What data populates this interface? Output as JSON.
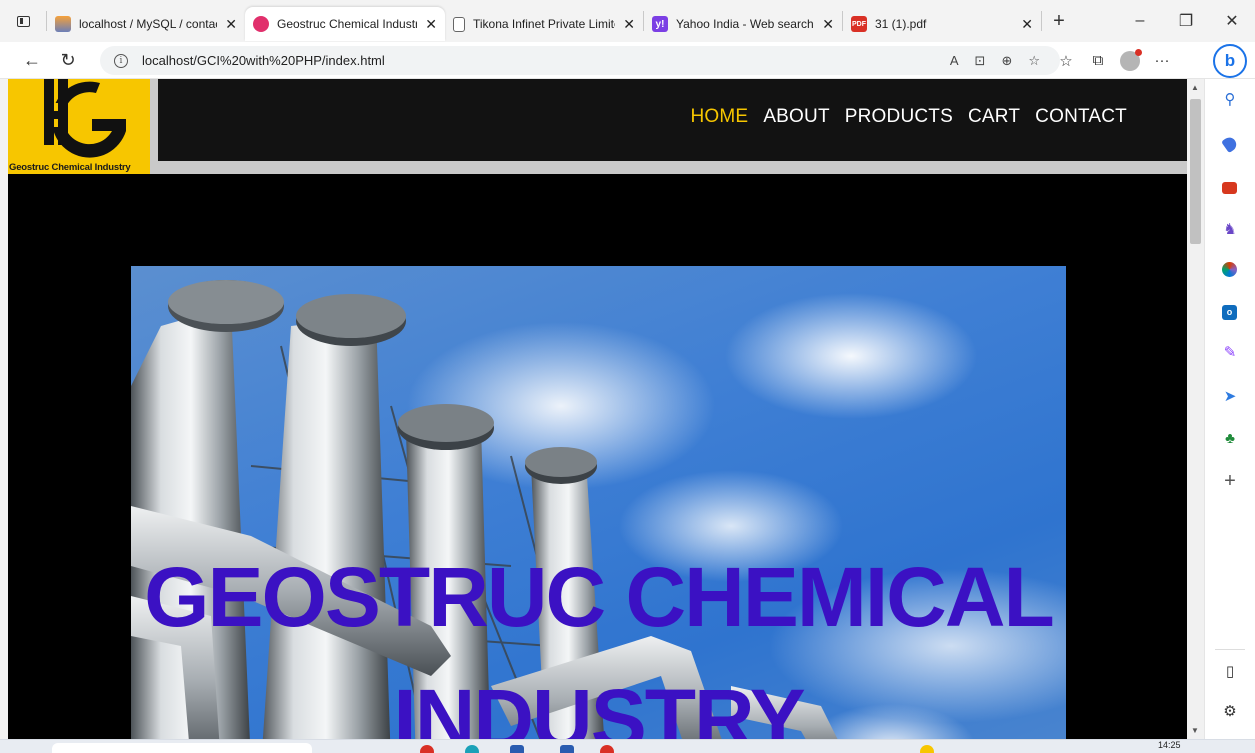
{
  "browser": {
    "tabs": [
      {
        "title": "localhost / MySQL / contactd",
        "favicon": "phpmyadmin-icon",
        "active": false
      },
      {
        "title": "Geostruc Chemical Industry",
        "favicon": "site-icon",
        "active": true
      },
      {
        "title": "Tikona Infinet Private Limited",
        "favicon": "document-icon",
        "active": false
      },
      {
        "title": "Yahoo India - Web search",
        "favicon": "yahoo-icon",
        "active": false
      },
      {
        "title": "31 (1).pdf",
        "favicon": "pdf-icon",
        "active": false
      }
    ],
    "close_glyph": "✕",
    "new_tab_glyph": "+",
    "window_controls": {
      "minimize": "–",
      "restore": "❐",
      "close": "✕"
    },
    "nav": {
      "back": "←",
      "refresh": "↻"
    },
    "address": {
      "info_glyph": "i",
      "url": "localhost/GCI%20with%20PHP/index.html"
    },
    "address_actions": {
      "read_aloud": "A",
      "immersive": "⊡",
      "zoom": "⊕",
      "favorite": "☆"
    },
    "toolbar": {
      "favorites": "☆",
      "collections": "⧉",
      "more": "···"
    },
    "copilot_glyph": "b"
  },
  "site": {
    "logo_text": "Geostruc Chemical Industry",
    "nav": [
      {
        "label": "HOME",
        "active": true
      },
      {
        "label": "ABOUT",
        "active": false
      },
      {
        "label": "PRODUCTS",
        "active": false
      },
      {
        "label": "CART",
        "active": false
      },
      {
        "label": "CONTACT",
        "active": false
      }
    ],
    "hero_title": "GEOSTRUC CHEMICAL INDUSTRY"
  },
  "sidebar": {
    "icons": [
      "search-icon",
      "shopping-tag-icon",
      "tools-bag-icon",
      "games-icon",
      "microsoft-365-icon",
      "outlook-icon",
      "designer-icon",
      "send-icon",
      "tree-icon",
      "add-icon",
      "panel-icon",
      "settings-icon"
    ],
    "outlook_letter": "o"
  },
  "taskbar": {
    "clock": "14:25"
  },
  "colors": {
    "accent_yellow": "#f7c600",
    "navbar_bg": "#121212",
    "hero_title": "#3b11c3",
    "edge_blue": "#1b73e8"
  }
}
